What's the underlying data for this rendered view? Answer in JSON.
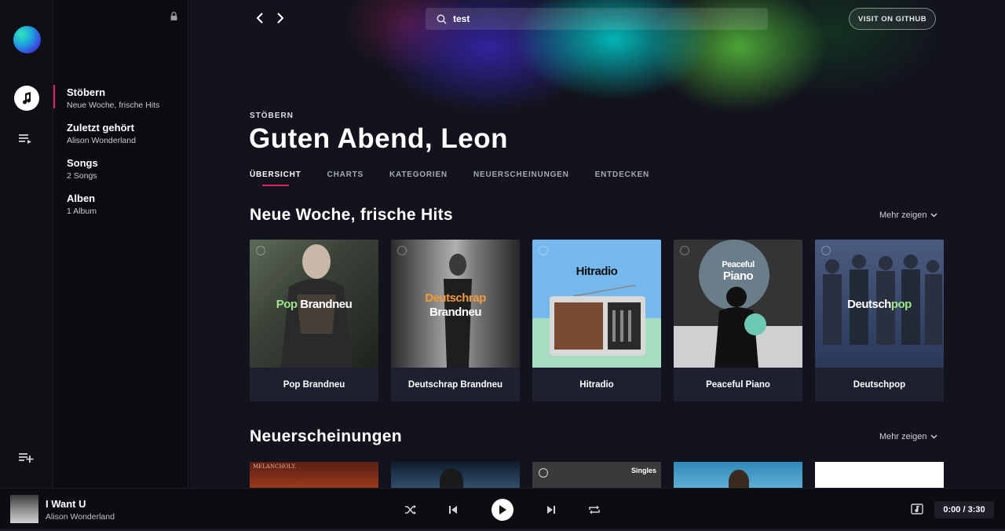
{
  "sidebar": {
    "items": [
      {
        "title": "Stöbern",
        "subtitle": "Neue Woche, frische Hits"
      },
      {
        "title": "Zuletzt gehört",
        "subtitle": "Alison Wonderland"
      },
      {
        "title": "Songs",
        "subtitle": "2 Songs"
      },
      {
        "title": "Alben",
        "subtitle": "1 Album"
      }
    ]
  },
  "header": {
    "search_value": "test",
    "github_label": "VISIT ON GITHUB"
  },
  "page": {
    "eyebrow": "STÖBERN",
    "greeting": "Guten Abend, Leon",
    "tabs": [
      {
        "label": "ÜBERSICHT"
      },
      {
        "label": "CHARTS"
      },
      {
        "label": "KATEGORIEN"
      },
      {
        "label": "NEUERSCHEINUNGEN"
      },
      {
        "label": "ENTDECKEN"
      }
    ]
  },
  "sections": [
    {
      "title": "Neue Woche, frische Hits",
      "more_label": "Mehr zeigen",
      "cards": [
        {
          "caption": "Pop Brandneu",
          "art_text_a": "Pop",
          "art_text_b": "Brandneu"
        },
        {
          "caption": "Deutschrap Brandneu",
          "art_text_a": "Deutschrap",
          "art_text_b": "Brandneu"
        },
        {
          "caption": "Hitradio",
          "art_text_a": "Hitradio"
        },
        {
          "caption": "Peaceful Piano",
          "art_text_a": "Peaceful",
          "art_text_b": "Piano"
        },
        {
          "caption": "Deutschpop",
          "art_text_a": "Deutsch",
          "art_text_b": "pop"
        }
      ]
    },
    {
      "title": "Neuerscheinungen",
      "more_label": "Mehr zeigen",
      "cards": [
        {
          "art_text": "MELANCHOLY."
        },
        {},
        {
          "art_text": "Singles"
        },
        {},
        {}
      ]
    }
  ],
  "player": {
    "title": "I Want U",
    "artist": "Alison Wonderland",
    "time": "0:00 / 3:30"
  },
  "colors": {
    "accent": "#e8215c",
    "card_bg": "#1e2030",
    "main_bg": "#12131c"
  }
}
